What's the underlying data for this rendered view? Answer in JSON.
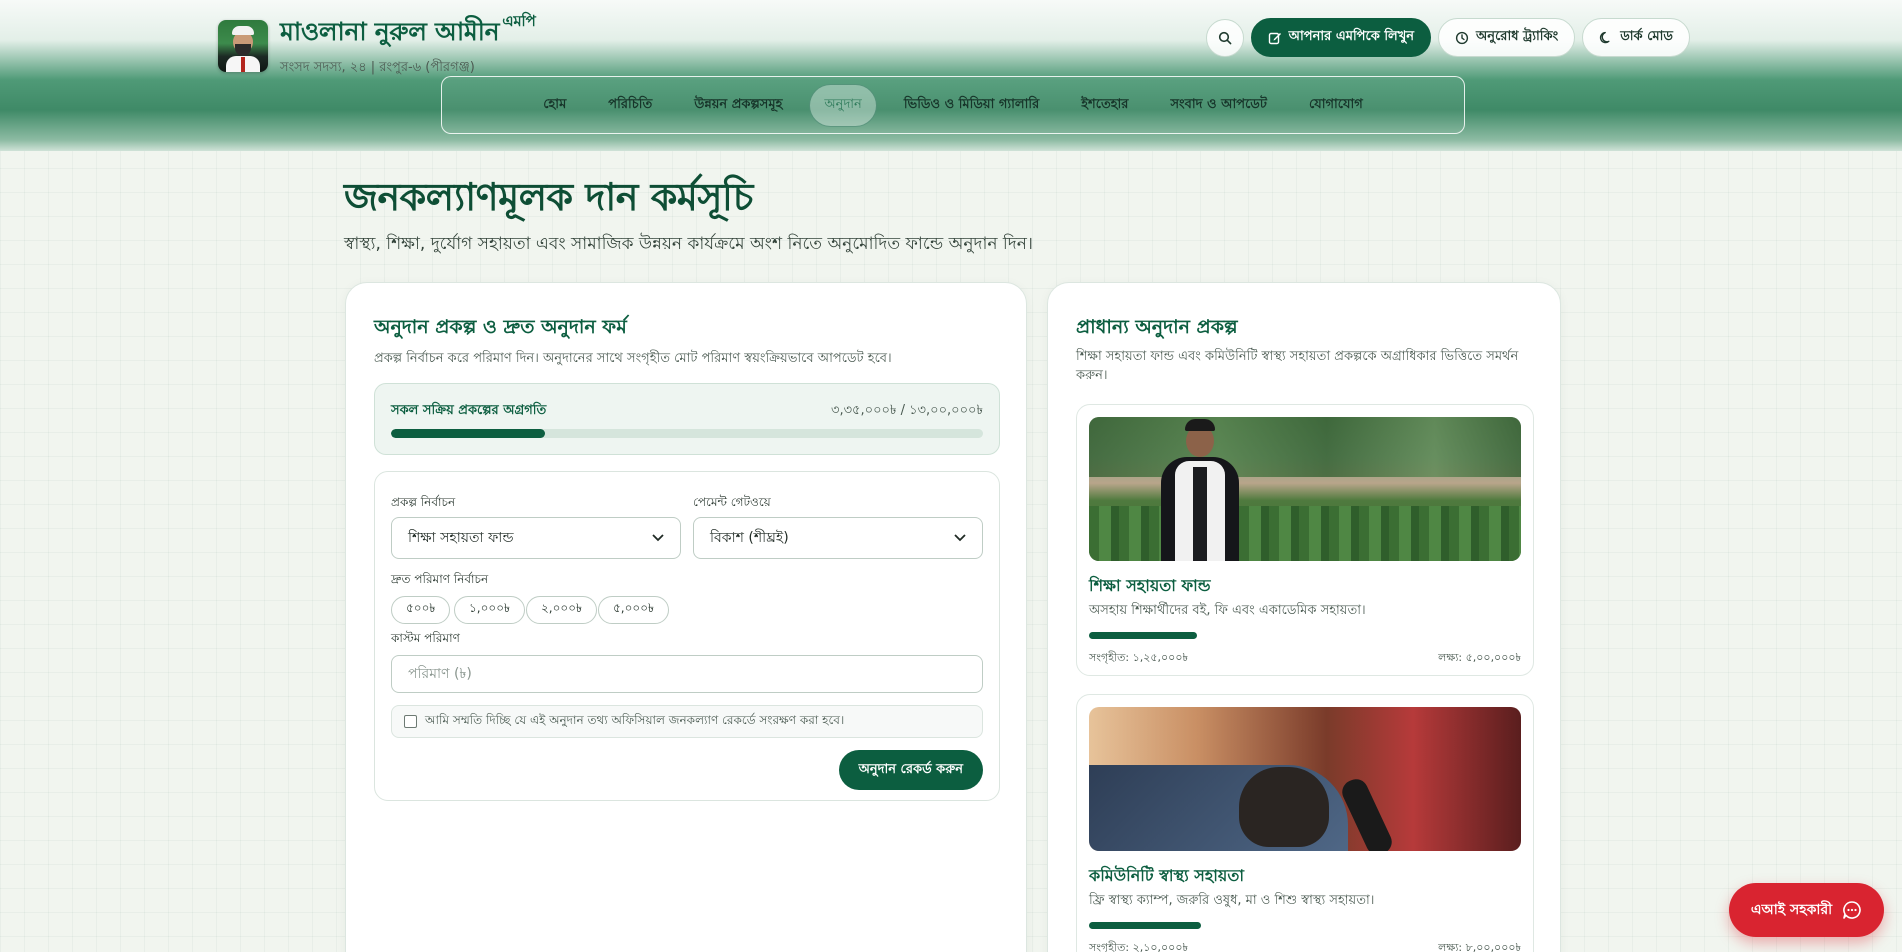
{
  "header": {
    "name": "মাওলানা নুরুল আমীন",
    "name_suffix": "এমপি",
    "subtitle": "সংসদ সদস্য, ২৪ | রংপুর-৬ (পীরগঞ্জ)",
    "write_button": "আপনার এমপিকে লিখুন",
    "tracking_button": "অনুরোধ ট্র্যাকিং",
    "dark_mode_button": "ডার্ক মোড"
  },
  "nav": {
    "items": [
      "হোম",
      "পরিচিতি",
      "উন্নয়ন প্রকল্পসমূহ",
      "অনুদান",
      "ভিডিও ও মিডিয়া গ্যালারি",
      "ইশতেহার",
      "সংবাদ ও আপডেট",
      "যোগাযোগ"
    ],
    "active": "অনুদান"
  },
  "page": {
    "title": "জনকল্যাণমূলক দান কর্মসূচি",
    "subtitle": "স্বাস্থ্য, শিক্ষা, দুর্যোগ সহায়তা এবং সামাজিক উন্নয়ন কার্যক্রমে অংশ নিতে অনুমোদিত ফান্ডে অনুদান দিন।"
  },
  "donation_form": {
    "title": "অনুদান প্রকল্প ও দ্রুত অনুদান ফর্ম",
    "description": "প্রকল্প নির্বাচন করে পরিমাণ দিন। অনুদানের সাথে সংগৃহীত মোট পরিমাণ স্বয়ংক্রিয়ভাবে আপডেট হবে।",
    "progress_label": "সকল সক্রিয় প্রকল্পের অগ্রগতি",
    "progress_amount": "৩,৩৫,০০০৳ / ১৩,০০,০০০৳",
    "progress_fraction": 0.26,
    "project_label": "প্রকল্প নির্বাচন",
    "project_value": "শিক্ষা সহায়তা ফান্ড",
    "gateway_label": "পেমেন্ট গেটওয়ে",
    "gateway_value": "বিকাশ (শীঘ্রই)",
    "quick_label": "দ্রুত পরিমাণ নির্বাচন",
    "quick_amounts": [
      "৫০০৳",
      "১,০০০৳",
      "২,০০০৳",
      "৫,০০০৳"
    ],
    "custom_label": "কাস্টম পরিমাণ",
    "custom_placeholder": "পরিমাণ (৳)",
    "consent_text": "আমি সম্মতি দিচ্ছি যে এই অনুদান তথ্য অফিসিয়াল জনকল্যাণ রেকর্ডে সংরক্ষণ করা হবে।",
    "submit_button": "অনুদান রেকর্ড করুন"
  },
  "priority": {
    "title": "প্রাধান্য অনুদান প্রকল্প",
    "description": "শিক্ষা সহায়তা ফান্ড এবং কমিউনিটি স্বাস্থ্য সহায়তা প্রকল্পকে অগ্রাধিকার ভিত্তিতে সমর্থন করুন।",
    "projects": [
      {
        "title": "শিক্ষা সহায়তা ফান্ড",
        "description": "অসহায় শিক্ষার্থীদের বই, ফি এবং একাডেমিক সহায়তা।",
        "raised": "সংগৃহীত: ১,২৫,০০০৳",
        "target": "লক্ষ্য: ৫,০০,০০০৳",
        "progress_fraction": 0.25
      },
      {
        "title": "কমিউনিটি স্বাস্থ্য সহায়তা",
        "description": "ফ্রি স্বাস্থ্য ক্যাম্প, জরুরি ওষুধ, মা ও শিশু স্বাস্থ্য সহায়তা।",
        "raised": "সংগৃহীত: ২,১০,০০০৳",
        "target": "লক্ষ্য: ৮,০০,০০০৳",
        "progress_fraction": 0.26
      }
    ]
  },
  "ai_assistant": {
    "label": "এআই সহকারী"
  },
  "colors": {
    "brand": "#0c5e40",
    "accent_red": "#d92430"
  }
}
